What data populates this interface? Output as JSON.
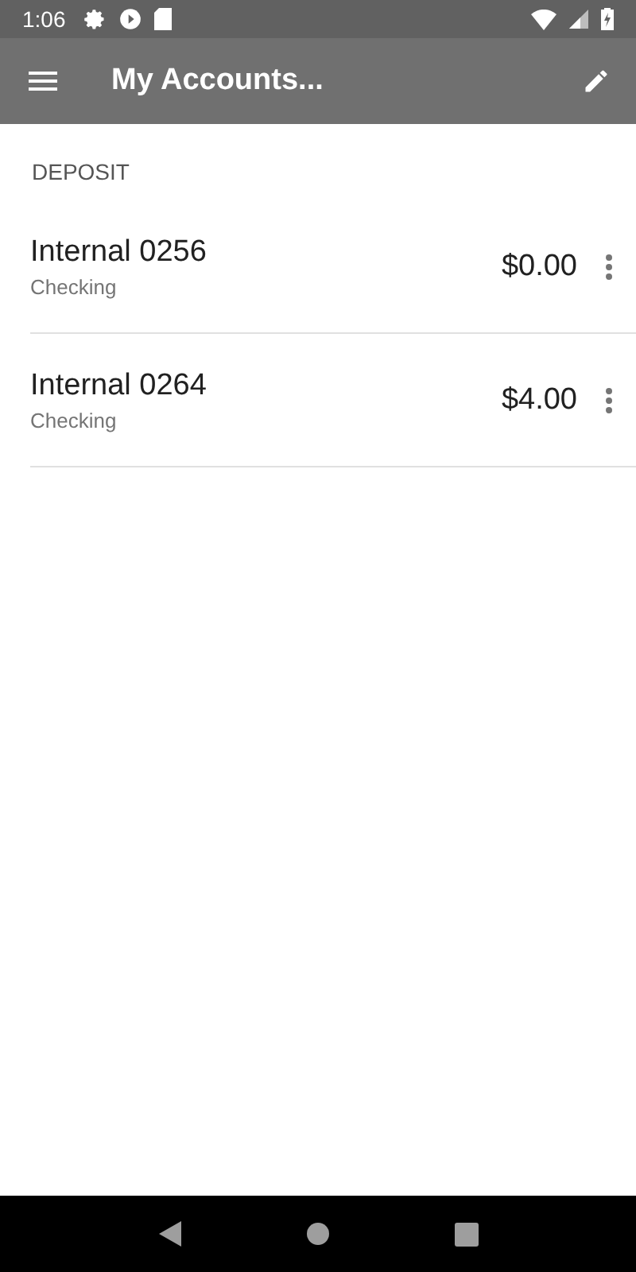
{
  "status_bar": {
    "time": "1:06"
  },
  "app_bar": {
    "title": "My Accounts..."
  },
  "section": {
    "title": "DEPOSIT"
  },
  "accounts": [
    {
      "name": "Internal 0256",
      "type": "Checking",
      "balance": "$0.00"
    },
    {
      "name": "Internal 0264",
      "type": "Checking",
      "balance": "$4.00"
    }
  ]
}
